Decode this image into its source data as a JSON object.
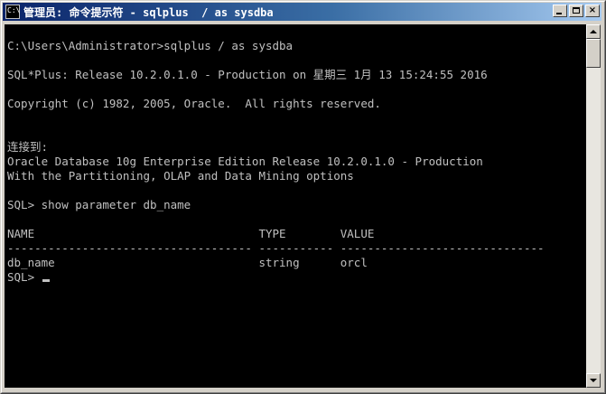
{
  "window": {
    "title": "管理员: 命令提示符 - sqlplus  / as sysdba",
    "icon": "cmd-icon",
    "buttons": {
      "minimize": "minimize-icon",
      "maximize": "maximize-icon",
      "close": "×"
    }
  },
  "console": {
    "background": "#000000",
    "foreground": "#c0c0c0",
    "lines": [
      "C:\\Users\\Administrator>sqlplus / as sysdba",
      "",
      "SQL*Plus: Release 10.2.0.1.0 - Production on 星期三 1月 13 15:24:55 2016",
      "",
      "Copyright (c) 1982, 2005, Oracle.  All rights reserved.",
      "",
      "",
      "连接到:",
      "Oracle Database 10g Enterprise Edition Release 10.2.0.1.0 - Production",
      "With the Partitioning, OLAP and Data Mining options",
      "",
      "SQL> show parameter db_name",
      "",
      "NAME                                 TYPE        VALUE",
      "------------------------------------ ----------- ------------------------------",
      "db_name                              string      orcl",
      "SQL> "
    ]
  },
  "title_colors": {
    "gradient_start": "#0a246a",
    "gradient_end": "#a6caf0"
  }
}
